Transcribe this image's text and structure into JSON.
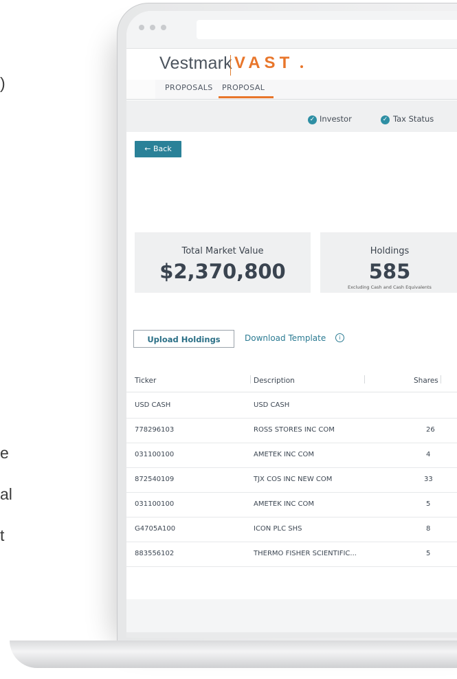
{
  "page_fragments": {
    "paren": ")",
    "letter_e": "e",
    "letters_al": "al",
    "letter_t": "t"
  },
  "app": {
    "brand_name": "Vestmark",
    "brand_product": "VAST"
  },
  "tabs": [
    {
      "label": "PROPOSALS"
    },
    {
      "label": "PROPOSAL"
    }
  ],
  "steps": [
    {
      "label": "Investor"
    },
    {
      "label": "Tax Status"
    }
  ],
  "back_button": "← Back",
  "summary": {
    "market_value_title": "Total Market Value",
    "market_value": "$2,370,800",
    "holdings_title": "Holdings",
    "holdings_count": "585",
    "holdings_note": "Excluding Cash and Cash Equivalents"
  },
  "actions": {
    "upload": "Upload Holdings",
    "download": "Download Template",
    "info_icon": "ⓘ"
  },
  "table": {
    "headers": [
      "Ticker",
      "Description",
      "Shares"
    ],
    "rows": [
      {
        "ticker": "USD CASH",
        "description": "USD CASH",
        "shares": ""
      },
      {
        "ticker": "778296103",
        "description": "ROSS STORES INC COM",
        "shares": "26"
      },
      {
        "ticker": "031100100",
        "description": "AMETEK INC COM",
        "shares": "4"
      },
      {
        "ticker": "872540109",
        "description": "TJX COS INC NEW COM",
        "shares": "33"
      },
      {
        "ticker": "031100100",
        "description": "AMETEK INC COM",
        "shares": "5"
      },
      {
        "ticker": "G4705A100",
        "description": "ICON PLC SHS",
        "shares": "8"
      },
      {
        "ticker": "883556102",
        "description": "THERMO FISHER SCIENTIFIC...",
        "shares": "5"
      }
    ]
  },
  "colors": {
    "accent_orange": "#e8762b",
    "accent_teal": "#2a8198",
    "check_teal": "#2e8fa4"
  }
}
